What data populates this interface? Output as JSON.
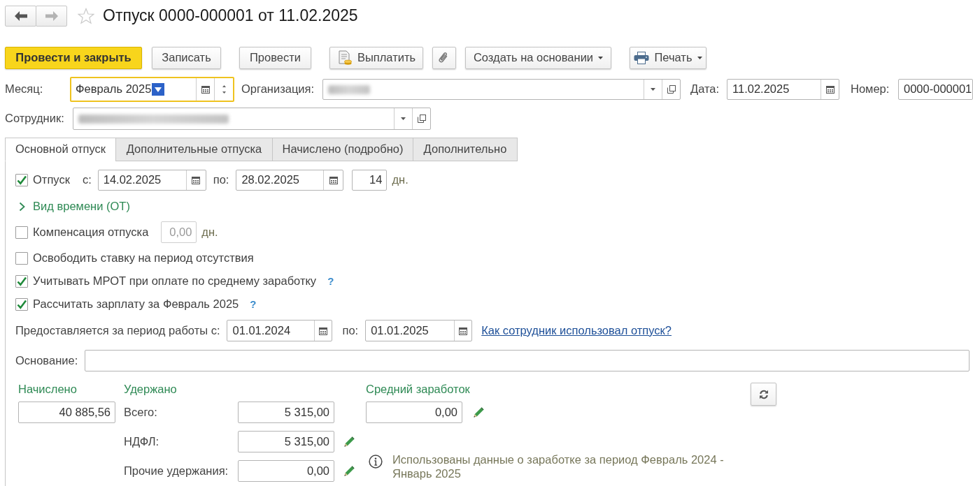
{
  "nav": [
    {
      "kind": "back",
      "disabled": false
    },
    {
      "kind": "forward",
      "disabled": true
    }
  ],
  "title": "Отпуск 0000-000001 от 11.02.2025",
  "favorite": false,
  "toolbar": [
    {
      "kind": "primary",
      "label": "Провести и закрыть",
      "dropdown": false
    },
    {
      "kind": "plain",
      "label": "Записать",
      "dropdown": false
    },
    {
      "kind": "plain",
      "label": "Провести",
      "dropdown": false
    },
    {
      "kind": "pay",
      "label": "Выплатить",
      "dropdown": false
    },
    {
      "kind": "attach",
      "dropdown": false
    },
    {
      "kind": "plain",
      "label": "Создать на основании",
      "dropdown": true
    },
    {
      "kind": "print",
      "label": "Печать",
      "dropdown": true
    }
  ],
  "header_fields": [
    {
      "kind": "month",
      "label": "Месяц:",
      "value": "Февраль 2025",
      "focused": true
    },
    {
      "kind": "ref",
      "label": "Организация:",
      "blurred": true,
      "focused": false
    },
    {
      "kind": "date",
      "label": "Дата:",
      "value": "11.02.2025",
      "focused": false
    },
    {
      "kind": "text",
      "label": "Номер:",
      "value": "0000-000001",
      "focused": false
    }
  ],
  "employee": {
    "label": "Сотрудник:",
    "blurred": true
  },
  "tabs": [
    {
      "label": "Основной отпуск",
      "selected": true
    },
    {
      "label": "Дополнительные отпуска",
      "selected": false
    },
    {
      "label": "Начислено (подробно)",
      "selected": false
    },
    {
      "label": "Дополнительно",
      "selected": false
    }
  ],
  "vacation": {
    "checked": true,
    "label": "Отпуск",
    "from_label": "с:",
    "from": "14.02.2025",
    "to_label": "по:",
    "to": "28.02.2025",
    "days": "14",
    "unit": "дн."
  },
  "time_kind": {
    "label": "Вид времени (ОТ)",
    "expanded": false
  },
  "compensation": {
    "checked": false,
    "label": "Компенсация отпуска",
    "value": "0,00",
    "disabled": true,
    "unit": "дн."
  },
  "options": [
    {
      "checked": false,
      "label": "Освободить ставку на период отсутствия"
    },
    {
      "checked": true,
      "label": "Учитывать МРОТ при оплате по среднему заработку",
      "help": "?"
    },
    {
      "checked": true,
      "label": "Рассчитать зарплату за Февраль 2025",
      "help": "?"
    }
  ],
  "period": {
    "label": "Предоставляется за период работы с:",
    "from": "01.01.2024",
    "to_label": "по:",
    "to": "01.01.2025",
    "link": "Как сотрудник использовал отпуск?"
  },
  "basis": {
    "label": "Основание:"
  },
  "accrued": {
    "title": "Начислено",
    "value": "40 885,56"
  },
  "withheld": {
    "title": "Удержано",
    "rows": [
      {
        "label": "Всего:",
        "value": "5 315,00",
        "editable": false
      },
      {
        "label": "НДФЛ:",
        "value": "5 315,00",
        "editable": true
      },
      {
        "label": "Прочие удержания:",
        "value": "0,00",
        "editable": true
      }
    ]
  },
  "average": {
    "title": "Средний заработок",
    "value": "0,00",
    "editable": true,
    "note": "Использованы данные о заработке за период Февраль 2024 - Январь 2025"
  }
}
